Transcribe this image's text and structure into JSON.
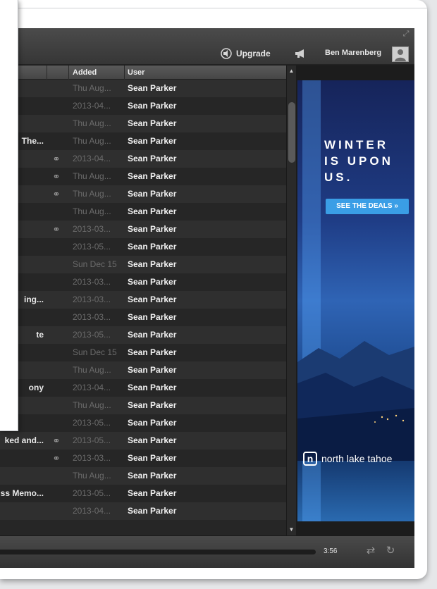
{
  "header": {
    "upgrade_label": "Upgrade",
    "username": "Ben Marenberg"
  },
  "table": {
    "columns": {
      "added": "Added",
      "user": "User"
    },
    "rows": [
      {
        "title": "",
        "link": false,
        "added": "Thu Aug...",
        "user": "Sean Parker"
      },
      {
        "title": "",
        "link": false,
        "added": "2013-04...",
        "user": "Sean Parker"
      },
      {
        "title": "",
        "link": false,
        "added": "Thu Aug...",
        "user": "Sean Parker"
      },
      {
        "title": "The...",
        "link": false,
        "added": "Thu Aug...",
        "user": "Sean Parker"
      },
      {
        "title": "",
        "link": true,
        "added": "2013-04...",
        "user": "Sean Parker"
      },
      {
        "title": "",
        "link": true,
        "added": "Thu Aug...",
        "user": "Sean Parker"
      },
      {
        "title": "",
        "link": true,
        "added": "Thu Aug...",
        "user": "Sean Parker"
      },
      {
        "title": "",
        "link": false,
        "added": "Thu Aug...",
        "user": "Sean Parker"
      },
      {
        "title": "",
        "link": true,
        "added": "2013-03...",
        "user": "Sean Parker"
      },
      {
        "title": "",
        "link": false,
        "added": "2013-05...",
        "user": "Sean Parker"
      },
      {
        "title": "",
        "link": false,
        "added": "Sun Dec 15",
        "user": "Sean Parker"
      },
      {
        "title": "",
        "link": false,
        "added": "2013-03...",
        "user": "Sean Parker"
      },
      {
        "title": "ing...",
        "link": false,
        "added": "2013-03...",
        "user": "Sean Parker"
      },
      {
        "title": "",
        "link": false,
        "added": "2013-03...",
        "user": "Sean Parker"
      },
      {
        "title": "te",
        "link": false,
        "added": "2013-05...",
        "user": "Sean Parker"
      },
      {
        "title": "",
        "link": false,
        "added": "Sun Dec 15",
        "user": "Sean Parker"
      },
      {
        "title": "",
        "link": false,
        "added": "Thu Aug...",
        "user": "Sean Parker"
      },
      {
        "title": "ony",
        "link": false,
        "added": "2013-04...",
        "user": "Sean Parker"
      },
      {
        "title": "",
        "link": false,
        "added": "Thu Aug...",
        "user": "Sean Parker"
      },
      {
        "title": "",
        "link": false,
        "added": "2013-05...",
        "user": "Sean Parker"
      },
      {
        "title": "ked and...",
        "link": true,
        "added": "2013-05...",
        "user": "Sean Parker"
      },
      {
        "title": "",
        "link": true,
        "added": "2013-03...",
        "user": "Sean Parker"
      },
      {
        "title": "",
        "link": false,
        "added": "Thu Aug...",
        "user": "Sean Parker"
      },
      {
        "title": "ss Memo...",
        "link": false,
        "added": "2013-05...",
        "user": "Sean Parker"
      },
      {
        "title": "",
        "link": false,
        "added": "2013-04...",
        "user": "Sean Parker"
      },
      {
        "title": "",
        "link": false,
        "added": "",
        "user": ""
      }
    ]
  },
  "ad": {
    "headline": [
      "WINTER",
      "IS UPON",
      "US."
    ],
    "cta": "SEE THE DEALS »",
    "brand_mark": "n",
    "brand": "north lake tahoe"
  },
  "player": {
    "time": "3:56"
  }
}
